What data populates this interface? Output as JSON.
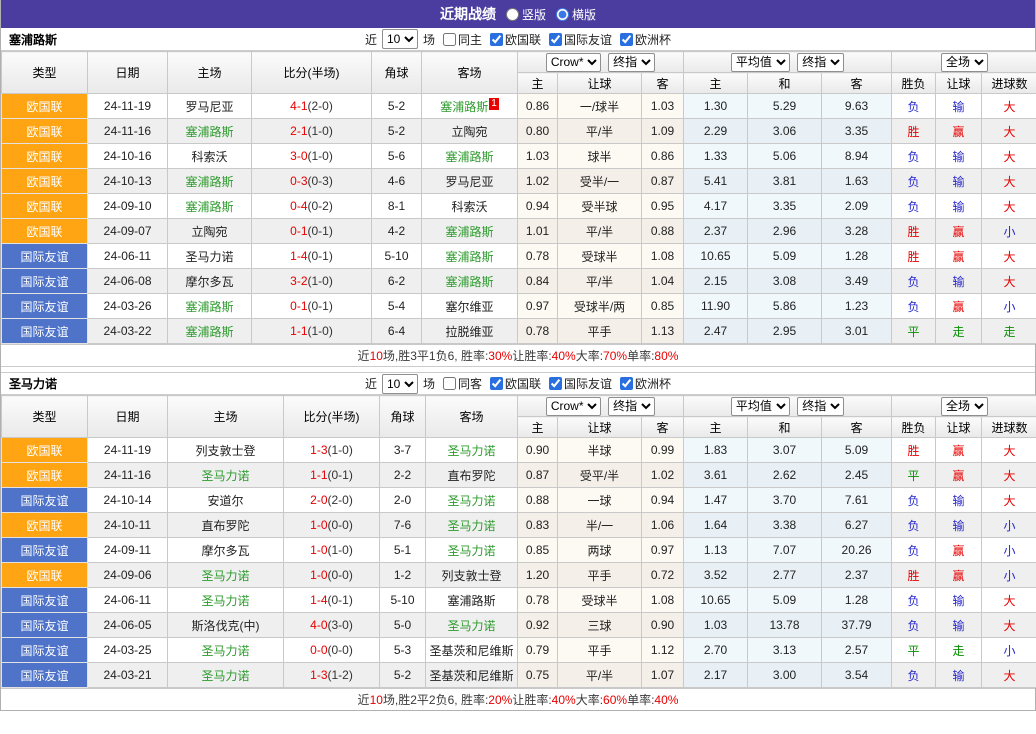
{
  "colors": {
    "accent-purple": "#4a3d9f",
    "league-orange": "#ffa413",
    "league-blue": "#4e73c9",
    "team-green": "#2e9b2e",
    "score-red": "#e80000",
    "lose-blue": "#2626cc",
    "draw-green": "#089000"
  },
  "title_bar": {
    "title": "近期战绩",
    "radio_vertical": "竖版",
    "radio_horizontal": "横版",
    "selected": "横版"
  },
  "sections": [
    {
      "team": "塞浦路斯",
      "filter": {
        "near_label": "近",
        "count": "10",
        "games_label": "场",
        "same_label": "同主",
        "same_checked": false,
        "leagues": [
          {
            "label": "欧国联",
            "checked": true
          },
          {
            "label": "国际友谊",
            "checked": true
          },
          {
            "label": "欧洲杯",
            "checked": true
          }
        ]
      },
      "header": {
        "col_type": "类型",
        "col_date": "日期",
        "col_home": "主场",
        "col_score": "比分(半场)",
        "col_corner": "角球",
        "col_away": "客场",
        "odds1_select": "Crow*",
        "odds1_final": "终指",
        "odds1_home": "主",
        "odds1_handicap": "让球",
        "odds1_away": "客",
        "odds2_select": "平均值",
        "odds2_final": "终指",
        "odds2_home": "主",
        "odds2_draw": "和",
        "odds2_away": "客",
        "result_select": "全场",
        "res_outcome": "胜负",
        "res_handicap": "让球",
        "res_goals": "进球数"
      },
      "rows": [
        {
          "type": "欧国联",
          "tc": "o",
          "date": "24-11-19",
          "home": "罗马尼亚",
          "hs": false,
          "score": "4-1",
          "half": "(2-0)",
          "corner": "5-2",
          "away": "塞浦路斯",
          "as": true,
          "badge": "1",
          "o1": "0.86",
          "hc": "一/球半",
          "o2": "1.03",
          "a1": "1.30",
          "a2": "5.29",
          "a3": "9.63",
          "r1": [
            "负",
            "b"
          ],
          "r2": [
            "输",
            "b"
          ],
          "r3": [
            "大",
            "r"
          ]
        },
        {
          "type": "欧国联",
          "tc": "o",
          "date": "24-11-16",
          "home": "塞浦路斯",
          "hs": true,
          "score": "2-1",
          "half": "(1-0)",
          "corner": "5-2",
          "away": "立陶宛",
          "as": false,
          "o1": "0.80",
          "hc": "平/半",
          "o2": "1.09",
          "a1": "2.29",
          "a2": "3.06",
          "a3": "3.35",
          "r1": [
            "胜",
            "r"
          ],
          "r2": [
            "赢",
            "r"
          ],
          "r3": [
            "大",
            "r"
          ]
        },
        {
          "type": "欧国联",
          "tc": "o",
          "date": "24-10-16",
          "home": "科索沃",
          "hs": false,
          "score": "3-0",
          "half": "(1-0)",
          "corner": "5-6",
          "away": "塞浦路斯",
          "as": true,
          "o1": "1.03",
          "hc": "球半",
          "o2": "0.86",
          "a1": "1.33",
          "a2": "5.06",
          "a3": "8.94",
          "r1": [
            "负",
            "b"
          ],
          "r2": [
            "输",
            "b"
          ],
          "r3": [
            "大",
            "r"
          ]
        },
        {
          "type": "欧国联",
          "tc": "o",
          "date": "24-10-13",
          "home": "塞浦路斯",
          "hs": true,
          "score": "0-3",
          "half": "(0-3)",
          "corner": "4-6",
          "away": "罗马尼亚",
          "as": false,
          "o1": "1.02",
          "hc": "受半/一",
          "o2": "0.87",
          "a1": "5.41",
          "a2": "3.81",
          "a3": "1.63",
          "r1": [
            "负",
            "b"
          ],
          "r2": [
            "输",
            "b"
          ],
          "r3": [
            "大",
            "r"
          ]
        },
        {
          "type": "欧国联",
          "tc": "o",
          "date": "24-09-10",
          "home": "塞浦路斯",
          "hs": true,
          "score": "0-4",
          "half": "(0-2)",
          "corner": "8-1",
          "away": "科索沃",
          "as": false,
          "o1": "0.94",
          "hc": "受半球",
          "o2": "0.95",
          "a1": "4.17",
          "a2": "3.35",
          "a3": "2.09",
          "r1": [
            "负",
            "b"
          ],
          "r2": [
            "输",
            "b"
          ],
          "r3": [
            "大",
            "r"
          ]
        },
        {
          "type": "欧国联",
          "tc": "o",
          "date": "24-09-07",
          "home": "立陶宛",
          "hs": false,
          "score": "0-1",
          "half": "(0-1)",
          "corner": "4-2",
          "away": "塞浦路斯",
          "as": true,
          "o1": "1.01",
          "hc": "平/半",
          "o2": "0.88",
          "a1": "2.37",
          "a2": "2.96",
          "a3": "3.28",
          "r1": [
            "胜",
            "r"
          ],
          "r2": [
            "赢",
            "r"
          ],
          "r3": [
            "小",
            "b"
          ]
        },
        {
          "type": "国际友谊",
          "tc": "b",
          "date": "24-06-11",
          "home": "圣马力诺",
          "hs": false,
          "score": "1-4",
          "half": "(0-1)",
          "corner": "5-10",
          "away": "塞浦路斯",
          "as": true,
          "o1": "0.78",
          "hc": "受球半",
          "o2": "1.08",
          "a1": "10.65",
          "a2": "5.09",
          "a3": "1.28",
          "r1": [
            "胜",
            "r"
          ],
          "r2": [
            "赢",
            "r"
          ],
          "r3": [
            "大",
            "r"
          ]
        },
        {
          "type": "国际友谊",
          "tc": "b",
          "date": "24-06-08",
          "home": "摩尔多瓦",
          "hs": false,
          "score": "3-2",
          "half": "(1-0)",
          "corner": "6-2",
          "away": "塞浦路斯",
          "as": true,
          "o1": "0.84",
          "hc": "平/半",
          "o2": "1.04",
          "a1": "2.15",
          "a2": "3.08",
          "a3": "3.49",
          "r1": [
            "负",
            "b"
          ],
          "r2": [
            "输",
            "b"
          ],
          "r3": [
            "大",
            "r"
          ]
        },
        {
          "type": "国际友谊",
          "tc": "b",
          "date": "24-03-26",
          "home": "塞浦路斯",
          "hs": true,
          "score": "0-1",
          "half": "(0-1)",
          "corner": "5-4",
          "away": "塞尔维亚",
          "as": false,
          "o1": "0.97",
          "hc": "受球半/两",
          "o2": "0.85",
          "a1": "11.90",
          "a2": "5.86",
          "a3": "1.23",
          "r1": [
            "负",
            "b"
          ],
          "r2": [
            "赢",
            "r"
          ],
          "r3": [
            "小",
            "b"
          ]
        },
        {
          "type": "国际友谊",
          "tc": "b",
          "date": "24-03-22",
          "home": "塞浦路斯",
          "hs": true,
          "score": "1-1",
          "half": "(1-0)",
          "corner": "6-4",
          "away": "拉脱维亚",
          "as": false,
          "o1": "0.78",
          "hc": "平手",
          "o2": "1.13",
          "a1": "2.47",
          "a2": "2.95",
          "a3": "3.01",
          "r1": [
            "平",
            "g"
          ],
          "r2": [
            "走",
            "g"
          ],
          "r3": [
            "走",
            "g"
          ]
        }
      ],
      "summary": [
        [
          "近",
          0
        ],
        [
          "10",
          1
        ],
        [
          "场,胜3平1负6, 胜率:",
          0
        ],
        [
          "30%",
          1
        ],
        [
          " 让胜率:",
          0
        ],
        [
          "40%",
          1
        ],
        [
          " 大率:",
          0
        ],
        [
          "70%",
          1
        ],
        [
          " 单率:",
          0
        ],
        [
          "80%",
          1
        ]
      ]
    },
    {
      "team": "圣马力诺",
      "filter": {
        "near_label": "近",
        "count": "10",
        "games_label": "场",
        "same_label": "同客",
        "same_checked": false,
        "leagues": [
          {
            "label": "欧国联",
            "checked": true
          },
          {
            "label": "国际友谊",
            "checked": true
          },
          {
            "label": "欧洲杯",
            "checked": true
          }
        ]
      },
      "header": {
        "col_type": "类型",
        "col_date": "日期",
        "col_home": "主场",
        "col_score": "比分(半场)",
        "col_corner": "角球",
        "col_away": "客场",
        "odds1_select": "Crow*",
        "odds1_final": "终指",
        "odds1_home": "主",
        "odds1_handicap": "让球",
        "odds1_away": "客",
        "odds2_select": "平均值",
        "odds2_final": "终指",
        "odds2_home": "主",
        "odds2_draw": "和",
        "odds2_away": "客",
        "result_select": "全场",
        "res_outcome": "胜负",
        "res_handicap": "让球",
        "res_goals": "进球数"
      },
      "rows": [
        {
          "type": "欧国联",
          "tc": "o",
          "date": "24-11-19",
          "home": "列支敦士登",
          "hs": false,
          "score": "1-3",
          "half": "(1-0)",
          "corner": "3-7",
          "away": "圣马力诺",
          "as": true,
          "o1": "0.90",
          "hc": "半球",
          "o2": "0.99",
          "a1": "1.83",
          "a2": "3.07",
          "a3": "5.09",
          "r1": [
            "胜",
            "r"
          ],
          "r2": [
            "赢",
            "r"
          ],
          "r3": [
            "大",
            "r"
          ]
        },
        {
          "type": "欧国联",
          "tc": "o",
          "date": "24-11-16",
          "home": "圣马力诺",
          "hs": true,
          "score": "1-1",
          "half": "(0-1)",
          "corner": "2-2",
          "away": "直布罗陀",
          "as": false,
          "o1": "0.87",
          "hc": "受平/半",
          "o2": "1.02",
          "a1": "3.61",
          "a2": "2.62",
          "a3": "2.45",
          "r1": [
            "平",
            "g"
          ],
          "r2": [
            "赢",
            "r"
          ],
          "r3": [
            "大",
            "r"
          ]
        },
        {
          "type": "国际友谊",
          "tc": "b",
          "date": "24-10-14",
          "home": "安道尔",
          "hs": false,
          "score": "2-0",
          "half": "(2-0)",
          "corner": "2-0",
          "away": "圣马力诺",
          "as": true,
          "o1": "0.88",
          "hc": "一球",
          "o2": "0.94",
          "a1": "1.47",
          "a2": "3.70",
          "a3": "7.61",
          "r1": [
            "负",
            "b"
          ],
          "r2": [
            "输",
            "b"
          ],
          "r3": [
            "大",
            "r"
          ]
        },
        {
          "type": "欧国联",
          "tc": "o",
          "date": "24-10-11",
          "home": "直布罗陀",
          "hs": false,
          "score": "1-0",
          "half": "(0-0)",
          "corner": "7-6",
          "away": "圣马力诺",
          "as": true,
          "o1": "0.83",
          "hc": "半/一",
          "o2": "1.06",
          "a1": "1.64",
          "a2": "3.38",
          "a3": "6.27",
          "r1": [
            "负",
            "b"
          ],
          "r2": [
            "输",
            "b"
          ],
          "r3": [
            "小",
            "b"
          ]
        },
        {
          "type": "国际友谊",
          "tc": "b",
          "date": "24-09-11",
          "home": "摩尔多瓦",
          "hs": false,
          "score": "1-0",
          "half": "(1-0)",
          "corner": "5-1",
          "away": "圣马力诺",
          "as": true,
          "o1": "0.85",
          "hc": "两球",
          "o2": "0.97",
          "a1": "1.13",
          "a2": "7.07",
          "a3": "20.26",
          "r1": [
            "负",
            "b"
          ],
          "r2": [
            "赢",
            "r"
          ],
          "r3": [
            "小",
            "b"
          ]
        },
        {
          "type": "欧国联",
          "tc": "o",
          "date": "24-09-06",
          "home": "圣马力诺",
          "hs": true,
          "score": "1-0",
          "half": "(0-0)",
          "corner": "1-2",
          "away": "列支敦士登",
          "as": false,
          "o1": "1.20",
          "hc": "平手",
          "o2": "0.72",
          "a1": "3.52",
          "a2": "2.77",
          "a3": "2.37",
          "r1": [
            "胜",
            "r"
          ],
          "r2": [
            "赢",
            "r"
          ],
          "r3": [
            "小",
            "b"
          ]
        },
        {
          "type": "国际友谊",
          "tc": "b",
          "date": "24-06-11",
          "home": "圣马力诺",
          "hs": true,
          "score": "1-4",
          "half": "(0-1)",
          "corner": "5-10",
          "away": "塞浦路斯",
          "as": false,
          "o1": "0.78",
          "hc": "受球半",
          "o2": "1.08",
          "a1": "10.65",
          "a2": "5.09",
          "a3": "1.28",
          "r1": [
            "负",
            "b"
          ],
          "r2": [
            "输",
            "b"
          ],
          "r3": [
            "大",
            "r"
          ]
        },
        {
          "type": "国际友谊",
          "tc": "b",
          "date": "24-06-05",
          "home": "斯洛伐克(中)",
          "hs": false,
          "score": "4-0",
          "half": "(3-0)",
          "corner": "5-0",
          "away": "圣马力诺",
          "as": true,
          "o1": "0.92",
          "hc": "三球",
          "o2": "0.90",
          "a1": "1.03",
          "a2": "13.78",
          "a3": "37.79",
          "r1": [
            "负",
            "b"
          ],
          "r2": [
            "输",
            "b"
          ],
          "r3": [
            "大",
            "r"
          ]
        },
        {
          "type": "国际友谊",
          "tc": "b",
          "date": "24-03-25",
          "home": "圣马力诺",
          "hs": true,
          "score": "0-0",
          "half": "(0-0)",
          "corner": "5-3",
          "away": "圣基茨和尼维斯",
          "as": false,
          "o1": "0.79",
          "hc": "平手",
          "o2": "1.12",
          "a1": "2.70",
          "a2": "3.13",
          "a3": "2.57",
          "r1": [
            "平",
            "g"
          ],
          "r2": [
            "走",
            "g"
          ],
          "r3": [
            "小",
            "b"
          ]
        },
        {
          "type": "国际友谊",
          "tc": "b",
          "date": "24-03-21",
          "home": "圣马力诺",
          "hs": true,
          "score": "1-3",
          "half": "(1-2)",
          "corner": "5-2",
          "away": "圣基茨和尼维斯",
          "as": false,
          "o1": "0.75",
          "hc": "平/半",
          "o2": "1.07",
          "a1": "2.17",
          "a2": "3.00",
          "a3": "3.54",
          "r1": [
            "负",
            "b"
          ],
          "r2": [
            "输",
            "b"
          ],
          "r3": [
            "大",
            "r"
          ]
        }
      ],
      "summary": [
        [
          "近",
          0
        ],
        [
          "10",
          1
        ],
        [
          "场,胜2平2负6, 胜率:",
          0
        ],
        [
          "20%",
          1
        ],
        [
          " 让胜率:",
          0
        ],
        [
          "40%",
          1
        ],
        [
          " 大率:",
          0
        ],
        [
          "60%",
          1
        ],
        [
          " 单率:",
          0
        ],
        [
          "40%",
          1
        ]
      ]
    }
  ]
}
